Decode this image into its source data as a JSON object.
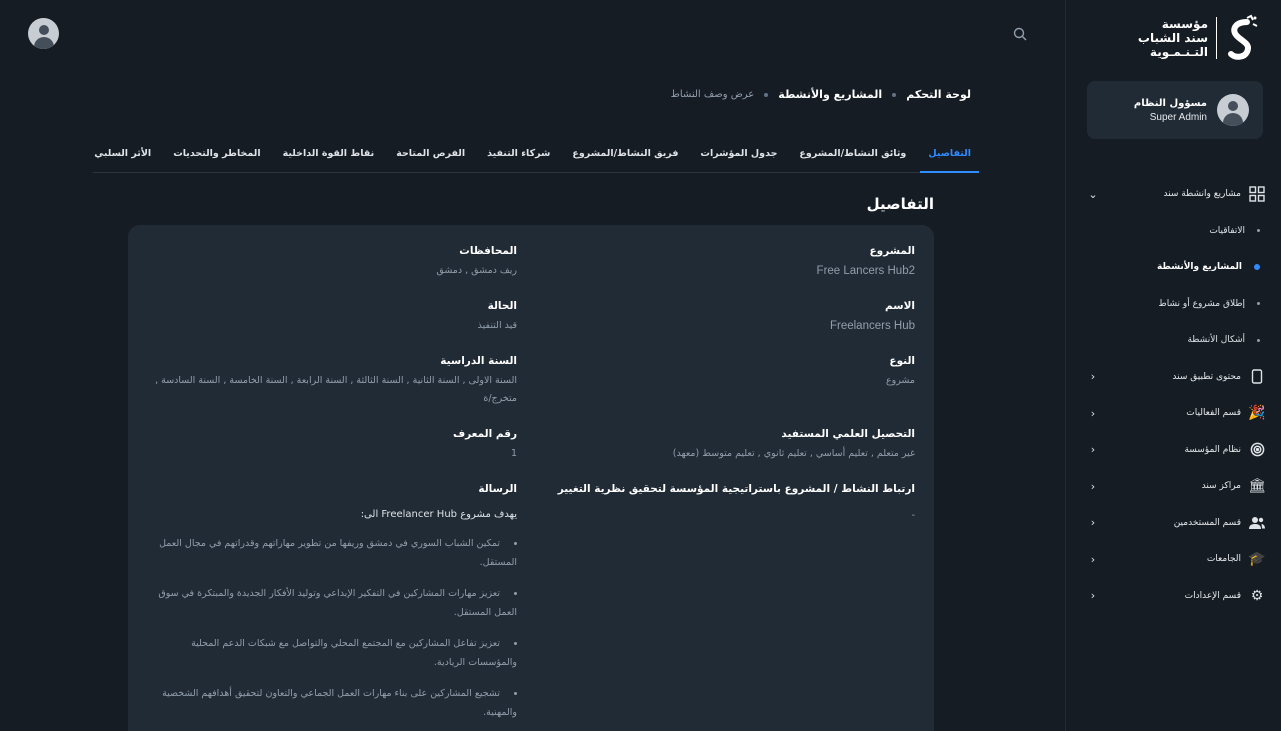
{
  "sidebar": {
    "logo": {
      "line1": "مؤسسة",
      "line2": "سند الشباب",
      "line3": "التـنـمـوية"
    },
    "user": {
      "name": "مسؤول النظام",
      "role": "Super Admin"
    },
    "nav": {
      "projects_group": "مشاريع وانشطة سند",
      "sub_items": [
        "الاتفاقيات",
        "المشاريع والأنشطة",
        "إطلاق مشروع أو نشاط",
        "أشكال الأنشطة"
      ],
      "items": [
        "محتوى تطبيق سند",
        "قسم الفعاليات",
        "نظام المؤسسة",
        "مراكز سند",
        "قسم المستخدمين",
        "الجامعات",
        "قسم الإعدادات"
      ]
    }
  },
  "breadcrumb": {
    "dashboard": "لوحة التحكم",
    "projects": "المشاريع والأنشطة",
    "current": "عرض وصف النشاط"
  },
  "tabs": [
    "التفاصيل",
    "وثائق النشاط/المشروع",
    "جدول المؤشرات",
    "فريق النشاط/المشروع",
    "شركاء التنفيذ",
    "الفرص المتاحة",
    "نقاط القوة الداخلية",
    "المخاطر والتحديات",
    "الأثر السلبي"
  ],
  "details": {
    "title": "التفاصيل",
    "project_label": "المشروع",
    "project_value": "Free Lancers Hub2",
    "name_label": "الاسم",
    "name_value": "Freelancers Hub",
    "type_label": "النوع",
    "type_value": "مشروع",
    "education_label": "التحصيل العلمي المستفيد",
    "education_value": "غير متعلم , تعليم أساسي , تعليم ثانوي , تعليم متوسط (معهد)",
    "strategy_label": "ارتباط النشاط / المشروع باستراتيجية المؤسسة لتحقيق نظرية التغيير",
    "strategy_value": "-",
    "governorates_label": "المحافظات",
    "governorates_value": "ريف دمشق , دمشق",
    "status_label": "الحالة",
    "status_value": "قيد التنفيذ",
    "year_label": "السنة الدراسية",
    "year_value": "السنة الاولى , السنة الثانية , السنة الثالثة , السنة الرابعة , السنة الخامسة , السنة السادسة , متخرج/ة",
    "id_label": "رقم المعرف",
    "id_value": "1",
    "message_label": "الرسالة",
    "message_intro": "يهدف مشروع Freelancer Hub الى:",
    "message_points": [
      "تمكين الشباب السوري في دمشق وريفها من تطوير مهاراتهم وقدراتهم في مجال العمل المستقل.",
      "تعزيز مهارات المشاركين في التفكير الإبداعي وتوليد الأفكار الجديدة والمبتكرة في سوق العمل المستقل.",
      "تعزيز تفاعل المشاركين مع المجتمع المحلي والتواصل مع شبكات الدعم المحلية والمؤسسات الريادية.",
      "تشجيع المشاركين على بناء مهارات العمل الجماعي والتعاون لتحقيق أهدافهم الشخصية والمهنية."
    ]
  },
  "colors": {
    "background": "#161c24",
    "card": "#212b36",
    "accent": "#2f8cff",
    "muted_text": "#919eab"
  }
}
